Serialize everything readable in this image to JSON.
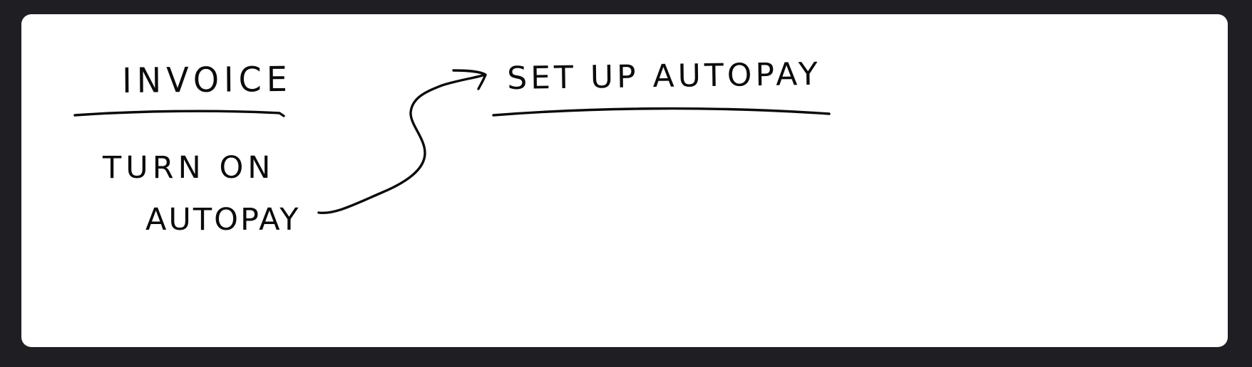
{
  "board": {
    "left_card": {
      "title": "INVOICE",
      "body_line1": "TURN ON",
      "body_line2": "AUTOPAY"
    },
    "right_card": {
      "title": "SET UP AUTOPAY"
    },
    "colors": {
      "background": "#1f1f23",
      "canvas": "#ffffff",
      "ink": "#0b0b0b"
    }
  }
}
